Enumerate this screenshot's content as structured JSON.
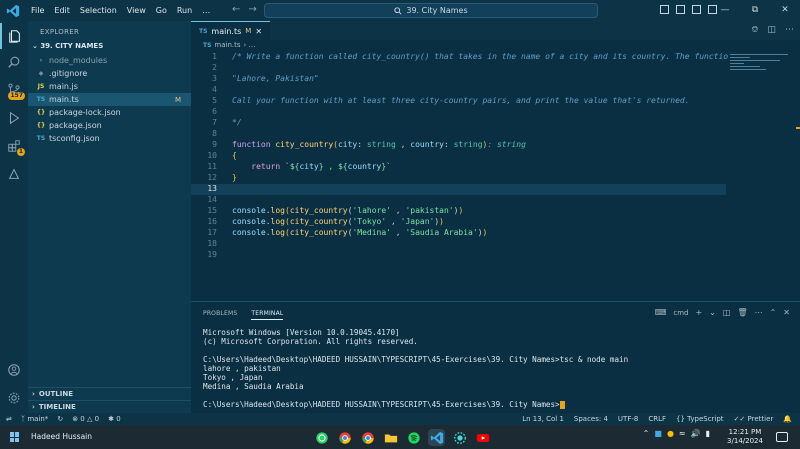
{
  "window": {
    "title": "39. City Names",
    "menu": [
      "File",
      "Edit",
      "Selection",
      "View",
      "Go",
      "Run",
      "…"
    ]
  },
  "activity": {
    "scm_badge": "157",
    "extensions_badge": "1"
  },
  "sidebar": {
    "title": "EXPLORER",
    "folder": "39. CITY NAMES",
    "items": [
      {
        "label": "node_modules",
        "icon": "›",
        "muted": true
      },
      {
        "label": ".gitignore",
        "icon": "◆"
      },
      {
        "label": "main.js",
        "icon": "JS"
      },
      {
        "label": "main.ts",
        "icon": "TS",
        "modified": "M"
      },
      {
        "label": "package-lock.json",
        "icon": "{}"
      },
      {
        "label": "package.json",
        "icon": "{}"
      },
      {
        "label": "tsconfig.json",
        "icon": "TS"
      }
    ],
    "outline": "OUTLINE",
    "timeline": "TIMELINE"
  },
  "editor": {
    "tab": {
      "label": "main.ts",
      "icon": "TS",
      "modified": "M"
    },
    "breadcrumb": {
      "icon": "TS",
      "file": "main.ts",
      "rest": "› …"
    },
    "line_numbers": [
      "1",
      "2",
      "3",
      "4",
      "5",
      "6",
      "7",
      "8",
      "9",
      "10",
      "11",
      "12",
      "13",
      "14",
      "15",
      "16",
      "17",
      "18",
      "19"
    ],
    "code": {
      "l1": "/* Write a function called city_country() that takes in the name of a city and its country. The functio",
      "l3": "\"Lahore, Pakistan\"",
      "l5": "Call your function with at least three city-country pairs, and print the value that's returned.",
      "l7": "*/",
      "l9_kw": "function",
      "l9_fn": "city_country",
      "l9_p1": "city",
      "l9_t1": "string",
      "l9_p2": "country",
      "l9_t2": "string",
      "l9_rt": "string",
      "l10": "{",
      "l11_kw": "return",
      "l11_s1": "`${",
      "l11_v1": "city",
      "l11_s2": "} , ${",
      "l11_v2": "country",
      "l11_s3": "}`",
      "l12": "}",
      "calls": [
        {
          "a": "'lahore'",
          "b": "'pakistan'"
        },
        {
          "a": "'Tokyo'",
          "b": "'Japan'"
        },
        {
          "a": "'Medina'",
          "b": "'Saudia Arabia'"
        }
      ],
      "console": "console",
      "log": "log",
      "call_fn": "city_country"
    }
  },
  "panel": {
    "tabs": [
      "PROBLEMS",
      "TERMINAL"
    ],
    "shell": "cmd",
    "terminal_lines": [
      "Microsoft Windows [Version 10.0.19045.4170]",
      "(c) Microsoft Corporation. All rights reserved.",
      "",
      "C:\\Users\\Hadeed\\Desktop\\HADEED HUSSAIN\\TYPESCRIPT\\45-Exercises\\39. City Names>tsc & node main",
      "lahore , pakistan",
      "Tokyo , Japan",
      "Medina , Saudia Arabia",
      ""
    ],
    "prompt": "C:\\Users\\Hadeed\\Desktop\\HADEED HUSSAIN\\TYPESCRIPT\\45-Exercises\\39. City Names>"
  },
  "status": {
    "branch": "main*",
    "errors": "0",
    "warnings": "0",
    "ports": "0",
    "position": "Ln 13, Col 1",
    "spaces": "Spaces: 4",
    "encoding": "UTF-8",
    "eol": "CRLF",
    "language": "TypeScript",
    "prettier": "Prettier"
  },
  "taskbar": {
    "user": "Hadeed Hussain",
    "time": "12:21 PM",
    "date": "3/14/2024"
  },
  "colors": {
    "accent": "#6fc3df",
    "badge": "#e8a317",
    "background": "#0b2f42"
  }
}
